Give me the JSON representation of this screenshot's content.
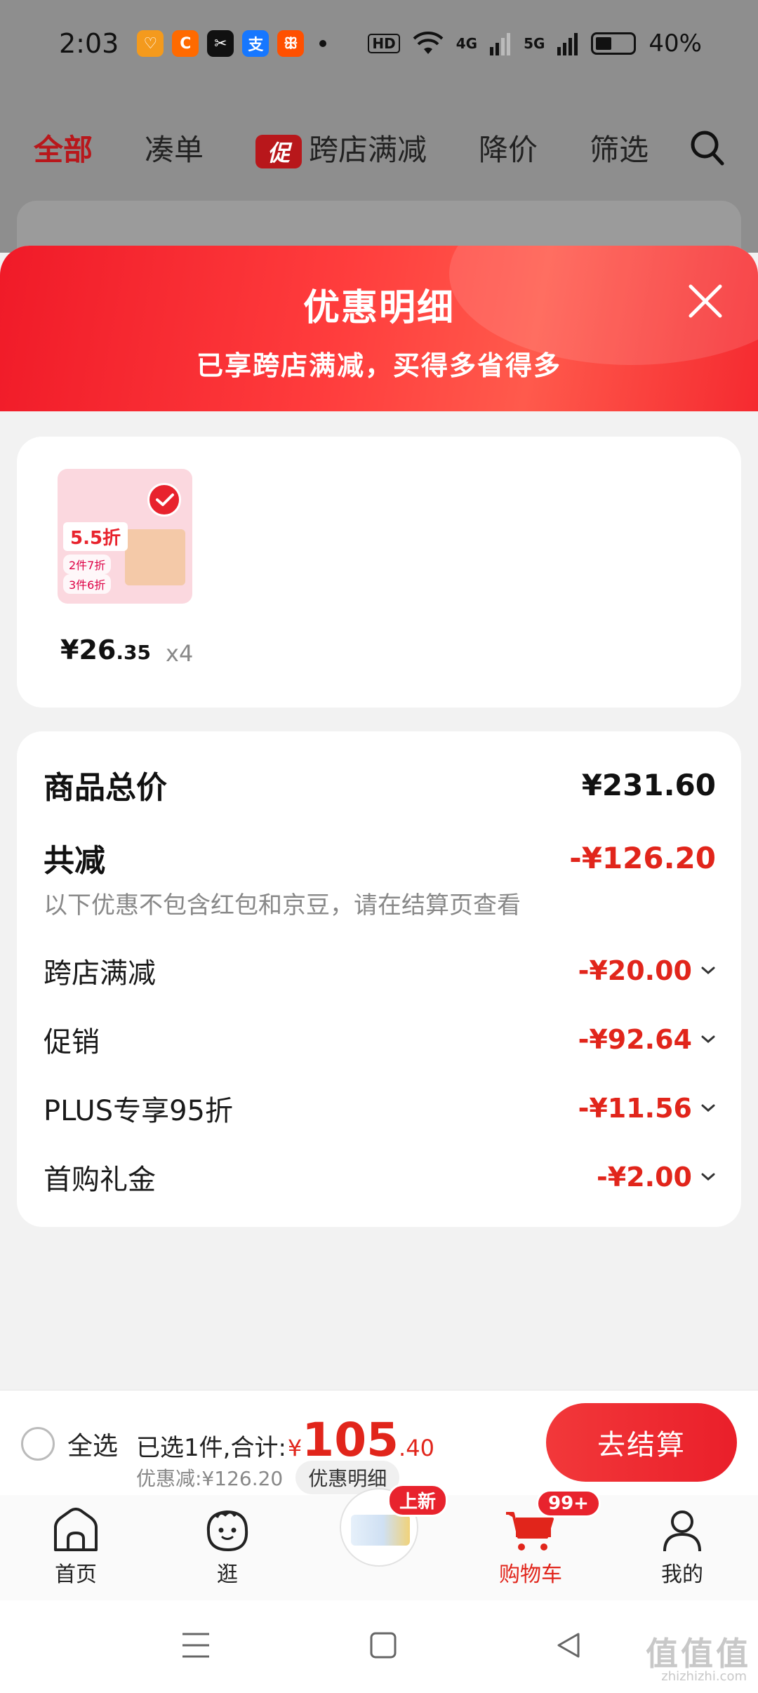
{
  "status_bar": {
    "time": "2:03",
    "app_icons": [
      {
        "name": "huawei-health-icon",
        "glyph": "♡",
        "color": "#f49a1d"
      },
      {
        "name": "1688-app-icon",
        "glyph": "C",
        "color": "#ff6a00"
      },
      {
        "name": "capcut-icon",
        "glyph": "✂",
        "color": "#111111"
      },
      {
        "name": "alipay-icon",
        "glyph": "支",
        "color": "#1677ff"
      },
      {
        "name": "taobao-icon",
        "glyph": "ꕥ",
        "color": "#ff5000"
      }
    ],
    "hd_label": "HD",
    "net_4g": "4G",
    "net_5g": "5G",
    "battery": "40%"
  },
  "filter_bar": {
    "all": "全部",
    "bundle": "凑单",
    "promo_tag": "促",
    "cross_store": "跨店满减",
    "price_drop": "降价",
    "filter": "筛选"
  },
  "sheet": {
    "title": "优惠明细",
    "subtitle": "已享跨店满减，买得多省得多",
    "product": {
      "badge": "5.5折",
      "chip1": "2件7折",
      "chip2": "3件6折",
      "price_int": "¥26",
      "price_dec": ".35",
      "qty": "x4"
    },
    "summary": {
      "total_label": "商品总价",
      "total_value": "¥231.60",
      "reduce_label": "共减",
      "reduce_value": "-¥126.20",
      "note": "以下优惠不包含红包和京豆，请在结算页查看",
      "items": [
        {
          "label": "跨店满减",
          "value": "-¥20.00"
        },
        {
          "label": "促销",
          "value": "-¥92.64"
        },
        {
          "label": "PLUS专享95折",
          "value": "-¥11.56"
        },
        {
          "label": "首购礼金",
          "value": "-¥2.00"
        }
      ]
    }
  },
  "checkout": {
    "select_all": "全选",
    "selected_text": "已选1件,合计:",
    "yen": "¥",
    "total_int": "105",
    "total_dec": ".40",
    "discount_text": "优惠减:¥126.20",
    "detail_button": "优惠明细",
    "checkout_button": "去结算"
  },
  "tab_bar": {
    "home": "首页",
    "browse": "逛",
    "new_badge": "上新",
    "cart": "购物车",
    "cart_badge": "99+",
    "me": "我的"
  },
  "watermark": {
    "text": "值值值",
    "sub": "zhizhizhi.com"
  },
  "colors": {
    "accent_red": "#e1251b",
    "header_red": "#f01a28",
    "dim_overlay": "#8e8e8e"
  }
}
